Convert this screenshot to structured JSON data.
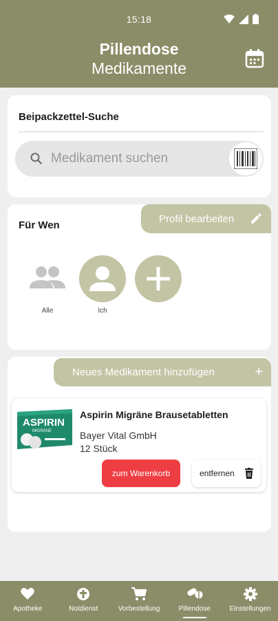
{
  "status": {
    "time": "15:18"
  },
  "header": {
    "title": "Pillendose",
    "subtitle": "Medikamente",
    "calendar_icon": "calendar-icon"
  },
  "search_section": {
    "title": "Beipackzettel-Suche",
    "placeholder": "Medikament suchen",
    "search_icon": "search-icon",
    "barcode_icon": "barcode-icon"
  },
  "profile_section": {
    "title": "Für Wen",
    "edit_label": "Profil bearbeiten",
    "profiles": [
      {
        "label": "Alle",
        "icon": "group-icon",
        "selected": false
      },
      {
        "label": "Ich",
        "icon": "person-icon",
        "selected": true
      }
    ],
    "add_icon": "plus-icon"
  },
  "medication_section": {
    "add_label": "Neues Medikament hinzufügen",
    "add_symbol": "+",
    "items": [
      {
        "name": "Aspirin Migräne Brausetabletten",
        "manufacturer": "Bayer Vital GmbH",
        "quantity": "12 Stück",
        "image_brand": "ASPIRIN",
        "image_sub": "MIGRÄNE",
        "cart_label": "zum Warenkorb",
        "remove_label": "entfernen"
      }
    ]
  },
  "nav": {
    "items": [
      {
        "label": "Apotheke",
        "icon": "heart-icon"
      },
      {
        "label": "Notdienst",
        "icon": "emergency-icon"
      },
      {
        "label": "Vorbestellung",
        "icon": "cart-icon"
      },
      {
        "label": "Pillendose",
        "icon": "pills-icon",
        "active": true
      },
      {
        "label": "Einstellungen",
        "icon": "gear-icon"
      }
    ]
  },
  "colors": {
    "brand": "#8b8d68",
    "accent_light": "#c2c4a4",
    "cart_red": "#ee3e44",
    "background": "#efefef"
  }
}
